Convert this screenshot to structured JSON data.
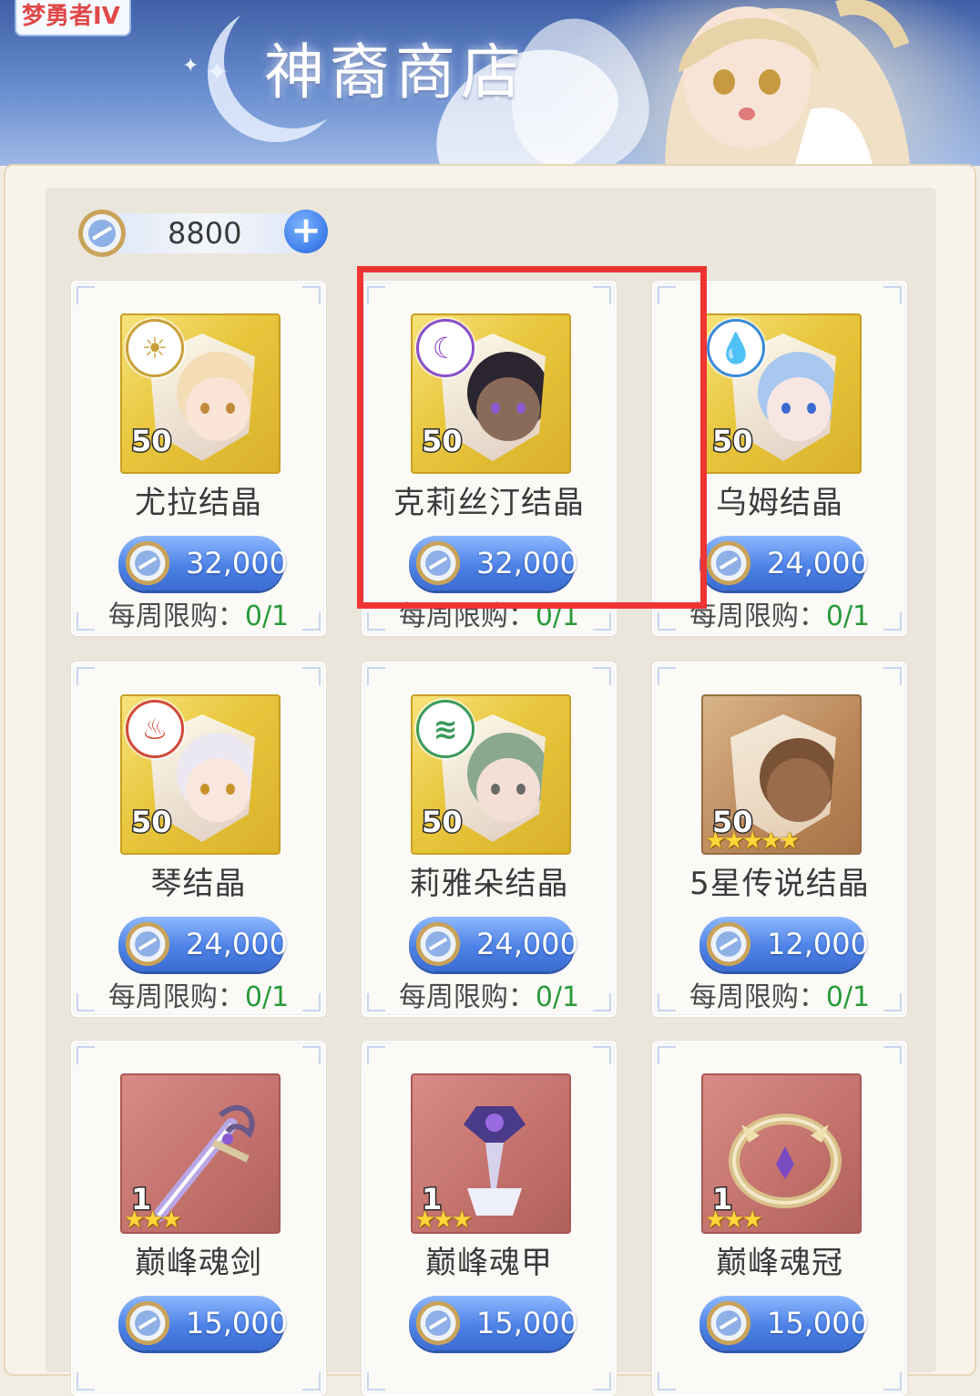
{
  "game_tag": "梦勇者IV",
  "shop_title": "神裔商店",
  "currency": {
    "amount": "8800",
    "add_icon": "plus-icon",
    "coin_icon": "coin-icon"
  },
  "items": [
    {
      "name": "尤拉结晶",
      "price": "32,000",
      "qty": "50",
      "limit_label": "每周限购：",
      "limit_count": "0/1",
      "type": "crystal",
      "element": "sun-icon",
      "element_color": "#c9a03a",
      "hair": "#f3dcb6",
      "skin": "#f9e4d6",
      "eye": "#c08a3a"
    },
    {
      "name": "克莉丝汀结晶",
      "price": "32,000",
      "qty": "50",
      "limit_label": "每周限购：",
      "limit_count": "0/1",
      "type": "crystal",
      "element": "moon-icon",
      "element_color": "#8a4fc9",
      "hair": "#2b2530",
      "skin": "#8a6b5a",
      "eye": "#8a5ad0"
    },
    {
      "name": "乌姆结晶",
      "price": "24,000",
      "qty": "50",
      "limit_label": "每周限购：",
      "limit_count": "0/1",
      "type": "crystal",
      "element": "water-icon",
      "element_color": "#3b8ad9",
      "hair": "#a9c8f0",
      "skin": "#f7e6e2",
      "eye": "#3a6ad0"
    },
    {
      "name": "琴结晶",
      "price": "24,000",
      "qty": "50",
      "limit_label": "每周限购：",
      "limit_count": "0/1",
      "type": "crystal",
      "element": "fire-icon",
      "element_color": "#d04a3a",
      "hair": "#ece8f2",
      "skin": "#f9e6dc",
      "eye": "#c8922a"
    },
    {
      "name": "莉雅朵结晶",
      "price": "24,000",
      "qty": "50",
      "limit_label": "每周限购：",
      "limit_count": "0/1",
      "type": "crystal",
      "element": "wind-icon",
      "element_color": "#3a9a5a",
      "hair": "#8aa890",
      "skin": "#f4dfd4",
      "eye": "#6a6a6a"
    },
    {
      "name": "5星传说结晶",
      "price": "12,000",
      "qty": "50",
      "limit_label": "每周限购：",
      "limit_count": "0/1",
      "type": "legend",
      "stars": "★★★★★"
    },
    {
      "name": "巅峰魂剑",
      "price": "15,000",
      "qty": "1",
      "type": "gear",
      "gear": "sword-icon",
      "stars": "★★★"
    },
    {
      "name": "巅峰魂甲",
      "price": "15,000",
      "qty": "1",
      "type": "gear",
      "gear": "armor-icon",
      "stars": "★★★"
    },
    {
      "name": "巅峰魂冠",
      "price": "15,000",
      "qty": "1",
      "type": "gear",
      "gear": "crown-icon",
      "stars": "★★★"
    }
  ],
  "highlighted_item": "克莉丝汀结晶"
}
